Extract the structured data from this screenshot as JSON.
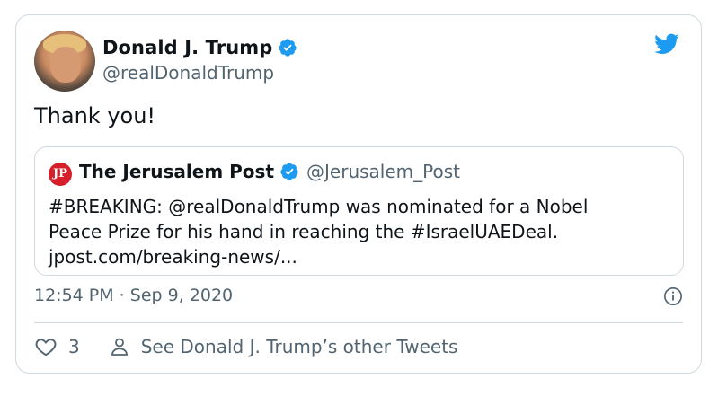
{
  "author": {
    "name": "Donald J. Trump",
    "handle": "@realDonaldTrump",
    "avatar_icon": "profile-photo",
    "verified": true
  },
  "tweet": {
    "text": "Thank you!",
    "timestamp": "12:54 PM · Sep 9, 2020"
  },
  "quoted_tweet": {
    "logo_text": "JPost",
    "name": "The Jerusalem Post",
    "handle": "@Jerusalem_Post",
    "line1": "#BREAKING: @realDonaldTrump was nominated for a Nobel",
    "line2": "Peace Prize for his hand in reaching the #IsraelUAEDeal.",
    "line3": "jpost.com/breaking-news/..."
  },
  "actions": {
    "like_count": "3",
    "other_tweets_label": "See Donald J. Trump’s other Tweets"
  },
  "colors": {
    "accent": "#1d9bf0",
    "secondary_text": "#536471",
    "border": "#cfd9de",
    "jpost_red": "#d5202b"
  }
}
